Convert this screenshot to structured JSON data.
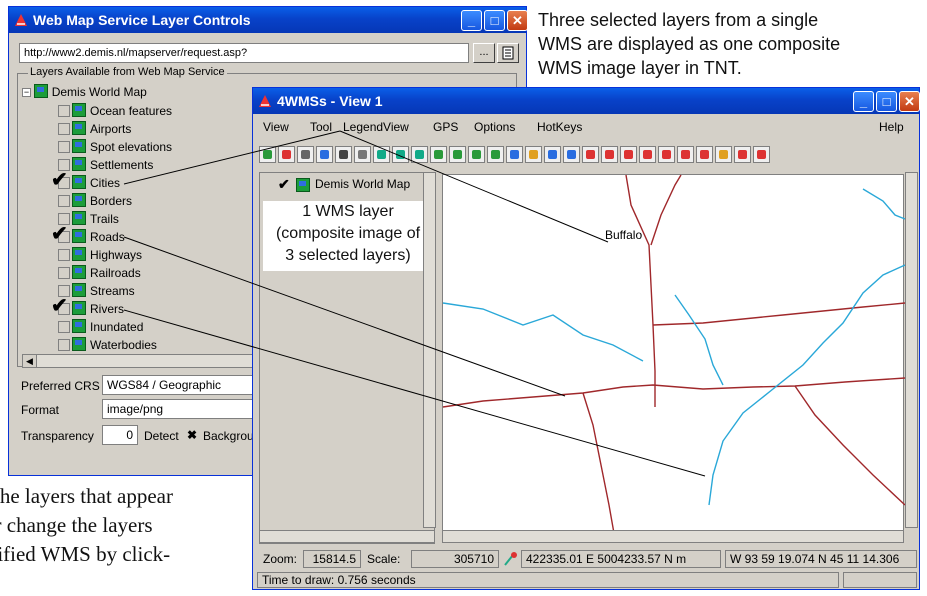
{
  "captions": {
    "top": [
      "Three selected layers from a single",
      "WMS are displayed as one composite",
      "WMS image layer in TNT."
    ],
    "bottom": [
      "the layers that appear",
      "or change the layers",
      "cified WMS by click-"
    ]
  },
  "wms_window": {
    "title": "Web Map Service Layer Controls",
    "url": "http://www2.demis.nl/mapserver/request.asp?",
    "browse_label": "...",
    "group_title": "Layers Available from Web Map Service",
    "root_expander": "−",
    "root_label": "Demis World Map",
    "layers": [
      {
        "label": "Ocean features",
        "checked": false
      },
      {
        "label": "Airports",
        "checked": false
      },
      {
        "label": "Spot elevations",
        "checked": false
      },
      {
        "label": "Settlements",
        "checked": false
      },
      {
        "label": "Cities",
        "checked": true
      },
      {
        "label": "Borders",
        "checked": false
      },
      {
        "label": "Trails",
        "checked": false
      },
      {
        "label": "Roads",
        "checked": true
      },
      {
        "label": "Highways",
        "checked": false
      },
      {
        "label": "Railroads",
        "checked": false
      },
      {
        "label": "Streams",
        "checked": false
      },
      {
        "label": "Rivers",
        "checked": true
      },
      {
        "label": "Inundated",
        "checked": false
      },
      {
        "label": "Waterbodies",
        "checked": false
      }
    ],
    "check_mark": "✔",
    "crs_label": "Preferred CRS",
    "crs_value": "WGS84 / Geographic",
    "format_label": "Format",
    "format_value": "image/png",
    "transparency_label": "Transparency",
    "transparency_value": "0",
    "detect_label": "Detect",
    "background_label": "Backgrou",
    "background_checked": "✖"
  },
  "view_window": {
    "title": "4WMSs - View 1",
    "menu": [
      "View",
      "Tool",
      "LegendView",
      "GPS",
      "Options",
      "HotKeys"
    ],
    "help": "Help",
    "legend_layer": "Demis World Map",
    "callout": [
      "1 WMS layer",
      "(composite image of",
      "3 selected layers)"
    ],
    "map_label": "Buffalo",
    "zoom_label": "Zoom:",
    "zoom_value": "15814.5",
    "scale_label": "Scale:",
    "scale_value": "305710",
    "coords_proj": "422335.01 E  5004233.57 N m",
    "coords_geo": "W 93 59 19.074  N 45 11 14.306",
    "status_time": "Time to draw: 0.756 seconds"
  },
  "colors": {
    "road": "#a0282b",
    "river": "#2aa8d8",
    "titlebar": "#0842c9",
    "window_bg": "#d4d0c8"
  },
  "icons": [
    "tnt-app-icon",
    "minimize-icon",
    "maximize-icon",
    "close-icon",
    "ellipsis-icon",
    "list-icon",
    "globe-layer-icon",
    "check-icon"
  ]
}
